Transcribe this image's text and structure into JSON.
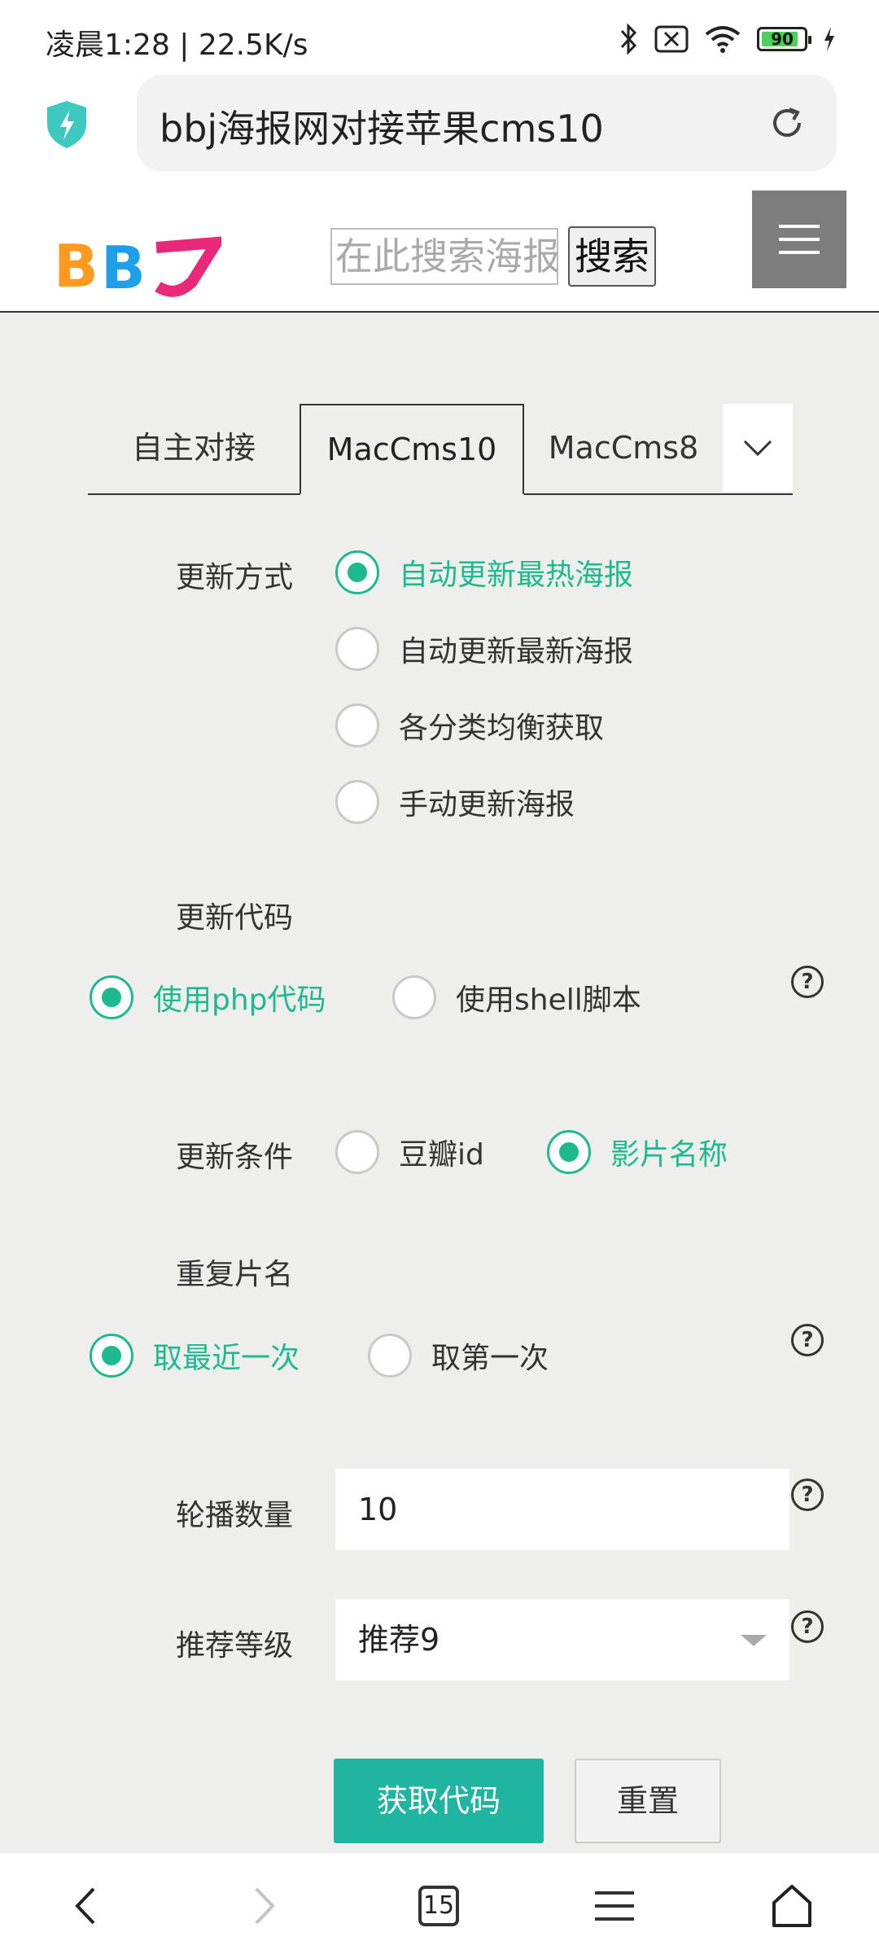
{
  "status": {
    "time": "凌晨1:28 | 22.5K/s",
    "battery": "90"
  },
  "browser": {
    "url_text": "bbj海报网对接苹果cms10",
    "tab_count": "15"
  },
  "site": {
    "logo_text": "BBJ",
    "search_placeholder": "在此搜索海报",
    "search_button": "搜索"
  },
  "tabs": [
    {
      "label": "自主对接"
    },
    {
      "label": "MacCms10"
    },
    {
      "label": "MacCms8"
    }
  ],
  "form": {
    "update_mode": {
      "label": "更新方式",
      "options": [
        "自动更新最热海报",
        "自动更新最新海报",
        "各分类均衡获取",
        "手动更新海报"
      ],
      "selected": "自动更新最热海报"
    },
    "update_code": {
      "label": "更新代码",
      "options": [
        "使用php代码",
        "使用shell脚本"
      ],
      "selected": "使用php代码"
    },
    "update_condition": {
      "label": "更新条件",
      "options": [
        "豆瓣id",
        "影片名称"
      ],
      "selected": "影片名称"
    },
    "duplicate_title": {
      "label": "重复片名",
      "options": [
        "取最近一次",
        "取第一次"
      ],
      "selected": "取最近一次"
    },
    "carousel_count": {
      "label": "轮播数量",
      "value": "10"
    },
    "recommend_level": {
      "label": "推荐等级",
      "value": "推荐9"
    },
    "help_symbol": "?",
    "submit": "获取代码",
    "reset": "重置"
  },
  "colors": {
    "accent": "#1fb98e",
    "button": "#1fb5a0"
  }
}
